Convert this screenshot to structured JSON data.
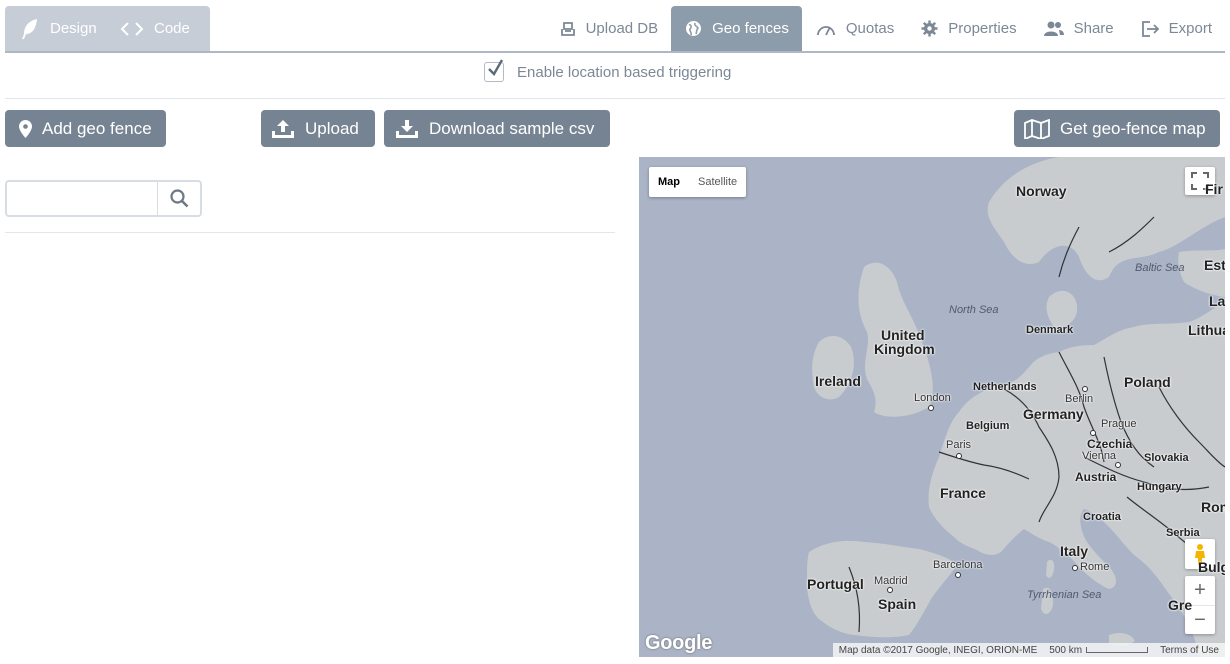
{
  "header": {
    "modes": [
      {
        "label": "Design",
        "icon": "feather-icon"
      },
      {
        "label": "Code",
        "icon": "code-icon"
      }
    ],
    "tabs": [
      {
        "label": "Upload DB",
        "icon": "database-icon",
        "active": false
      },
      {
        "label": "Geo fences",
        "icon": "globe-icon",
        "active": true
      },
      {
        "label": "Quotas",
        "icon": "gauge-icon",
        "active": false
      },
      {
        "label": "Properties",
        "icon": "gear-icon",
        "active": false
      },
      {
        "label": "Share",
        "icon": "users-icon",
        "active": false
      },
      {
        "label": "Export",
        "icon": "export-icon",
        "active": false
      }
    ]
  },
  "settings": {
    "enable_location_label": "Enable location based triggering",
    "enable_location_checked": true
  },
  "toolbar": {
    "add_label": "Add geo fence",
    "upload_label": "Upload",
    "download_label": "Download sample csv",
    "map_label": "Get geo-fence map"
  },
  "search": {
    "value": "",
    "placeholder": ""
  },
  "map": {
    "type_map": "Map",
    "type_satellite": "Satellite",
    "logo": "Google",
    "attribution": "Map data ©2017 Google, INEGI, ORION-ME",
    "scale": "500 km",
    "terms": "Terms of Use",
    "labels": {
      "norway": "Norway",
      "baltic_sea": "Baltic Sea",
      "est": "Est",
      "fir": "Fir",
      "la": "La",
      "lithuania": "Lithuani",
      "north_sea": "North Sea",
      "uk1": "United",
      "uk2": "Kingdom",
      "denmark": "Denmark",
      "ireland": "Ireland",
      "netherlands": "Netherlands",
      "berlin": "Berlin",
      "poland": "Poland",
      "london": "London",
      "germany": "Germany",
      "belgium": "Belgium",
      "prague": "Prague",
      "paris": "Paris",
      "czechia": "Czechia",
      "vienna": "Vienna",
      "slovakia": "Slovakia",
      "austria": "Austria",
      "hungary": "Hungary",
      "france": "France",
      "roma": "Roma",
      "croatia": "Croatia",
      "serbia": "Serbia",
      "italy": "Italy",
      "barcelona": "Barcelona",
      "rome": "Rome",
      "bulg": "Bulg",
      "portugal": "Portugal",
      "madrid": "Madrid",
      "spain": "Spain",
      "tyrrhenian": "Tyrrhenian Sea",
      "gre": "Gre"
    }
  }
}
